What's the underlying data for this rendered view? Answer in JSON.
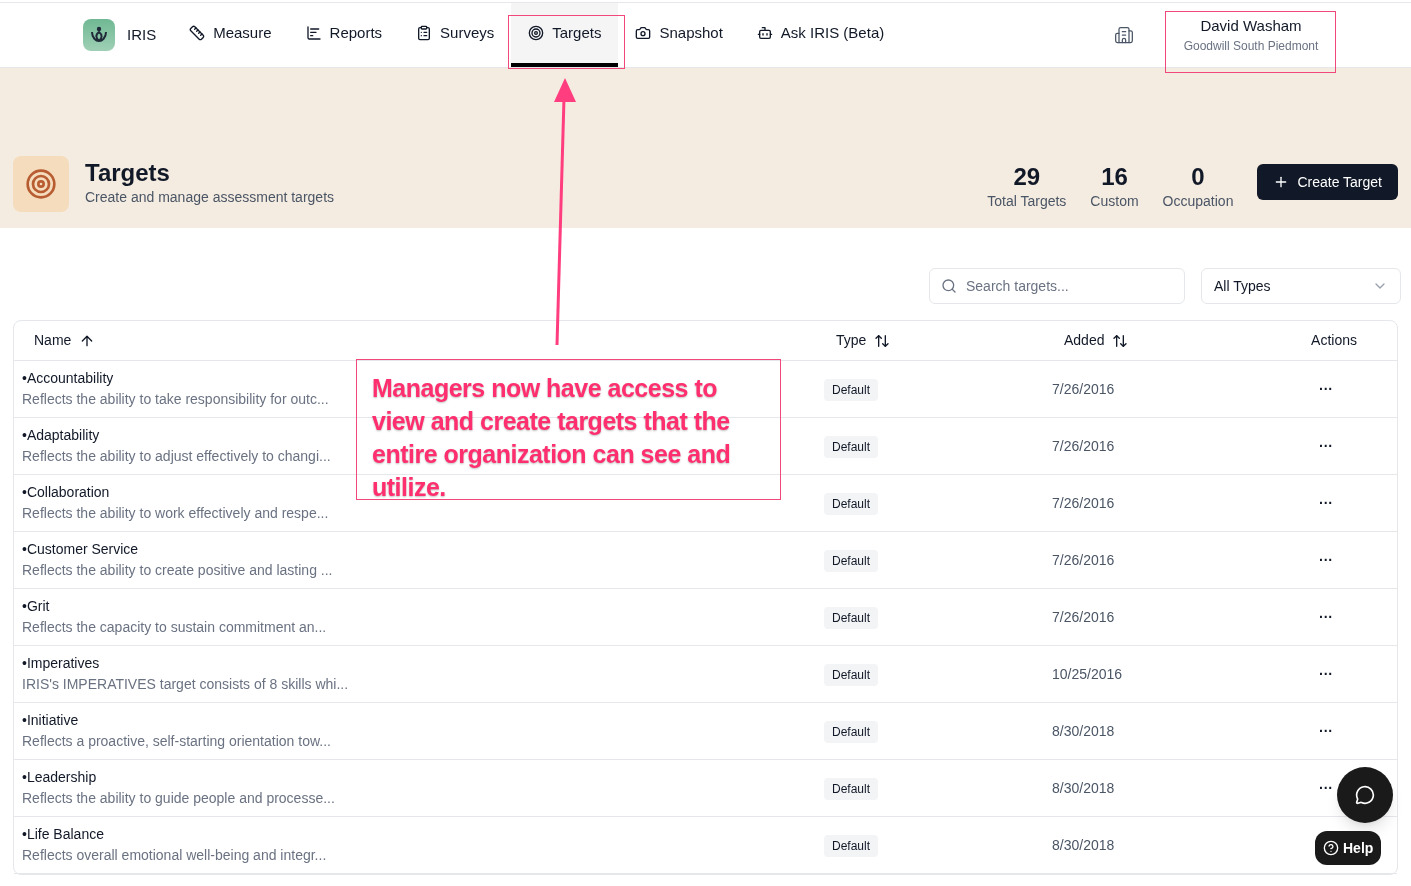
{
  "nav": {
    "brand": "IRIS",
    "tabs": [
      {
        "kind": "measure",
        "label": "Measure",
        "selected": false
      },
      {
        "kind": "reports",
        "label": "Reports",
        "selected": false
      },
      {
        "kind": "surveys",
        "label": "Surveys",
        "selected": false
      },
      {
        "kind": "targets",
        "label": "Targets",
        "selected": true
      },
      {
        "kind": "snapshot",
        "label": "Snapshot",
        "selected": false
      },
      {
        "kind": "ask",
        "label": "Ask IRIS (Beta)",
        "selected": false
      }
    ],
    "user": {
      "name": "David Washam",
      "org": "Goodwill South Piedmont"
    }
  },
  "header": {
    "title": "Targets",
    "subtitle": "Create and manage assessment targets",
    "stats": [
      {
        "value": "29",
        "label": "Total Targets"
      },
      {
        "value": "16",
        "label": "Custom"
      },
      {
        "value": "0",
        "label": "Occupation"
      }
    ],
    "create_button": "Create Target"
  },
  "filters": {
    "search": {
      "placeholder": "Search targets..."
    },
    "type_select": "All Types"
  },
  "table": {
    "columns": [
      {
        "label": "Name",
        "sorted": true
      },
      {
        "label": "Type",
        "sorted": false
      },
      {
        "label": "Added",
        "sorted": false
      },
      {
        "label": "Actions"
      }
    ],
    "rows": [
      {
        "name": "•Accountability",
        "description": "Reflects the ability to take responsibility for outc...",
        "type": "Default",
        "added": "7/26/2016",
        "action": "···"
      },
      {
        "name": "•Adaptability",
        "description": "Reflects the ability to adjust effectively to changi...",
        "type": "Default",
        "added": "7/26/2016",
        "action": "···"
      },
      {
        "name": "•Collaboration",
        "description": "Reflects the ability to work effectively and respe...",
        "type": "Default",
        "added": "7/26/2016",
        "action": "···"
      },
      {
        "name": "•Customer Service",
        "description": "Reflects the ability to create positive and lasting ...",
        "type": "Default",
        "added": "7/26/2016",
        "action": "···"
      },
      {
        "name": "•Grit",
        "description": "Reflects the capacity to sustain commitment an...",
        "type": "Default",
        "added": "7/26/2016",
        "action": "···"
      },
      {
        "name": "•Imperatives",
        "description": "IRIS's IMPERATIVES target consists of 8 skills whi...",
        "type": "Default",
        "added": "10/25/2016",
        "action": "···"
      },
      {
        "name": "•Initiative",
        "description": "Reflects a proactive, self-starting orientation tow...",
        "type": "Default",
        "added": "8/30/2018",
        "action": "···"
      },
      {
        "name": "•Leadership",
        "description": "Reflects the ability to guide people and processe...",
        "type": "Default",
        "added": "8/30/2018",
        "action": "···"
      },
      {
        "name": "•Life Balance",
        "description": "Reflects overall emotional well-being and integr...",
        "type": "Default",
        "added": "8/30/2018"
      }
    ]
  },
  "help_button": "Help",
  "annotation": {
    "callout": "Managers now have access to view and create targets that the entire organization can see and utilize."
  }
}
